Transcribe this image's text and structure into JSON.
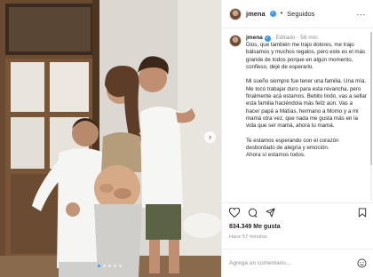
{
  "header": {
    "username": "jmena",
    "separator": "•",
    "follow_status": "Seguidos",
    "more": "···"
  },
  "caption": {
    "username": "jmena",
    "status": "Editado",
    "time_ago": "56 min",
    "text": "Dios, que también me trajo dolores, me trajo bálsamos y muchos regalos, pero este es el más grande de todos porque en algún momento, confieso, dejé de esperarlo.\n\nMi sueño siempre fue tener una familia. Una mía.\nMe tocó trabajar duro para esta revancha, pero finalmente acá estamos. Bebito lindo, vas a sellar esta familia haciéndola más feliz aún. Vas a hacer papá a Matías, hermano a Momo y a mi mamá otra vez, que nada me gusta más en la vida que ser mamá, ahora tu mamá.\n\nTe estamos esperando con el corazón desbordado de alegría y emoción.\nAhora sí estamos todos."
  },
  "post": {
    "likes": "834.349 Me gusta",
    "time": "Hace 57 minutos"
  },
  "comment": {
    "placeholder": "Agrega un comentario..."
  },
  "carousel": {
    "next": "›",
    "slides": 5,
    "active_slide": 1
  },
  "colors": {
    "verified": "#3897f0",
    "text": "#262626",
    "secondary": "#8e8e8e"
  }
}
